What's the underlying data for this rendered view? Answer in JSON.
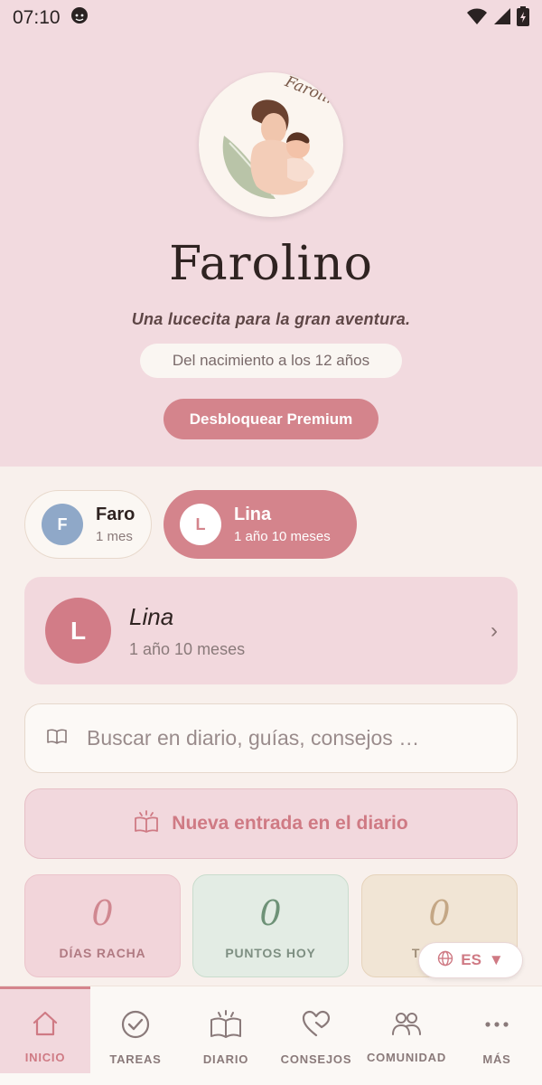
{
  "status_bar": {
    "time": "07:10"
  },
  "hero": {
    "logo_text": "Farolino",
    "app_title": "Farolino",
    "tagline": "Una lucecita para la gran aventura.",
    "age_range": "Del nacimiento a los 12 años",
    "premium_button": "Desbloquear Premium"
  },
  "children": [
    {
      "initial": "F",
      "name": "Faro",
      "age": "1 mes",
      "selected": false
    },
    {
      "initial": "L",
      "name": "Lina",
      "age": "1 año 10 meses",
      "selected": true
    }
  ],
  "profile_card": {
    "initial": "L",
    "name": "Lina",
    "age": "1 año 10 meses"
  },
  "search": {
    "placeholder": "Buscar en diario, guías, consejos …"
  },
  "diary_button": {
    "label": "Nueva entrada en el diario"
  },
  "stats": [
    {
      "value": "0",
      "label": "DÍAS RACHA"
    },
    {
      "value": "0",
      "label": "PUNTOS HOY"
    },
    {
      "value": "0",
      "label": "TAREAS"
    }
  ],
  "language": {
    "code": "ES",
    "arrow": "▼"
  },
  "bottom_nav": [
    {
      "label": "INICIO",
      "icon": "home-icon",
      "active": true
    },
    {
      "label": "TAREAS",
      "icon": "check-circle-icon",
      "active": false
    },
    {
      "label": "DIARIO",
      "icon": "book-icon",
      "active": false
    },
    {
      "label": "CONSEJOS",
      "icon": "heart-icon",
      "active": false
    },
    {
      "label": "COMUNIDAD",
      "icon": "people-icon",
      "active": false
    },
    {
      "label": "MÁS",
      "icon": "more-icon",
      "active": false
    }
  ],
  "colors": {
    "accent": "#d4848c",
    "hero_bg": "#f2dadf",
    "page_bg": "#f8f0ec",
    "faro_avatar": "#8fa8c8"
  }
}
